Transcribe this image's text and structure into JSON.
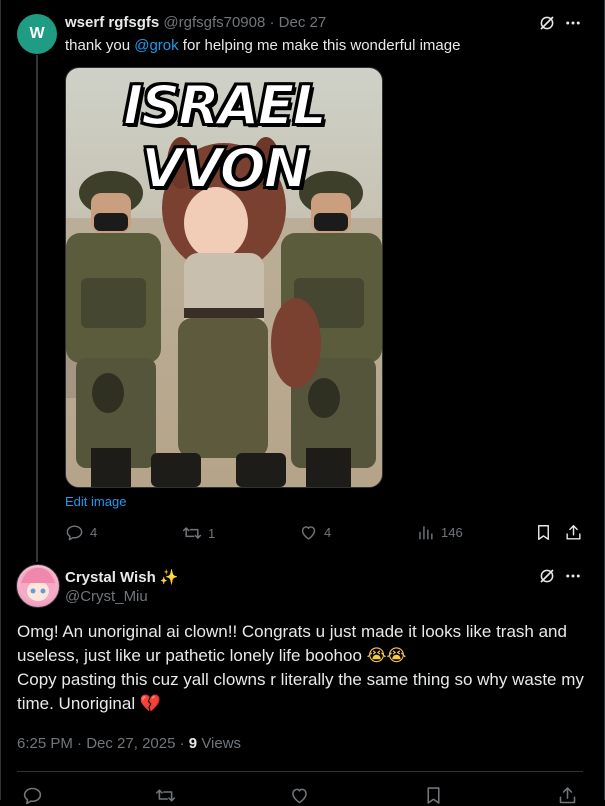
{
  "tweet1": {
    "avatar_letter": "W",
    "avatar_color": "#1e9c84",
    "display_name": "wserf rgfsgfs",
    "handle": "@rgfsgfs70908",
    "separator": "·",
    "date": "Dec 27",
    "text_before": "thank you ",
    "mention": "@grok",
    "text_after": " for helping me make this wonderful image",
    "image_text": "ISRAEL VVON",
    "edit_image_label": "Edit image",
    "actions": {
      "replies": "4",
      "reposts": "1",
      "likes": "4",
      "views": "146"
    }
  },
  "tweet2": {
    "display_name": "Crystal Wish",
    "name_emoji": "✨",
    "handle": "@Cryst_Miu",
    "line1": "Omg! An unoriginal ai clown!! Congrats u just made it looks like trash and useless, just like ur pathetic lonely life boohoo",
    "line1_emoji": "😭😭",
    "line2": "Copy pasting this cuz yall clowns r literally the same thing so why waste my time. Unoriginal",
    "line2_emoji": "💔",
    "time": "6:25 PM",
    "date": "Dec 27, 2025",
    "views_count": "9",
    "views_label": "Views"
  },
  "icons": [
    "grok-icon",
    "more-icon",
    "reply-icon",
    "repost-icon",
    "like-icon",
    "views-icon",
    "bookmark-icon",
    "share-icon"
  ],
  "colors": {
    "accent": "#1d9bf0",
    "muted": "#71767b",
    "text": "#e7e9ea",
    "background": "#000000"
  }
}
